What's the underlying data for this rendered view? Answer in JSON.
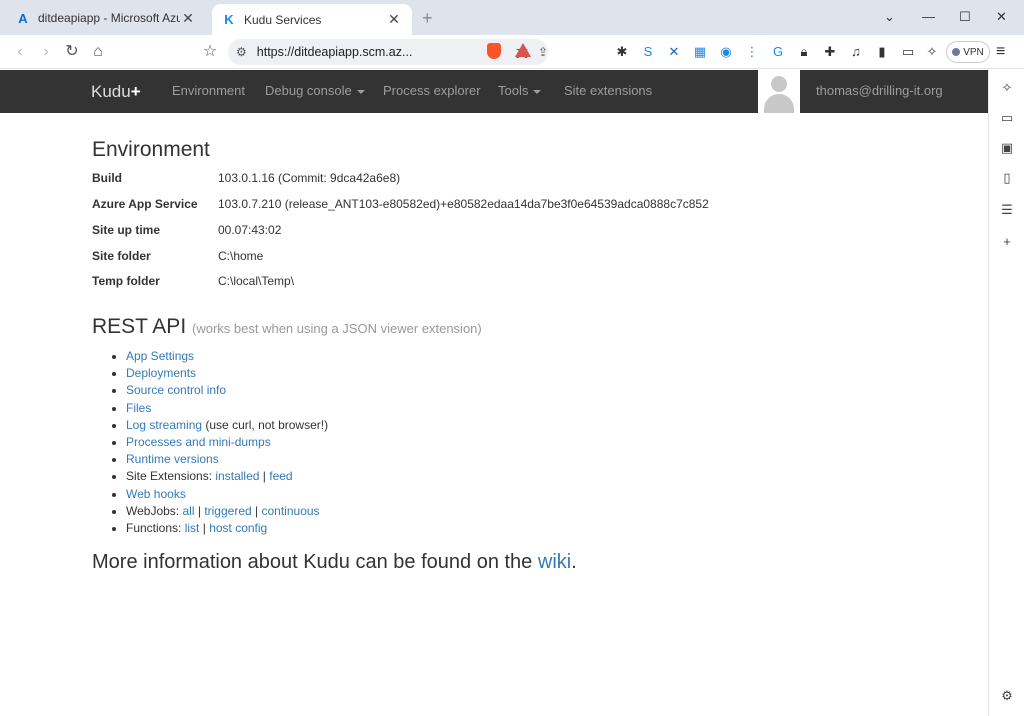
{
  "browser": {
    "tabs": [
      {
        "title": "ditdeapiapp - Microsoft Azure",
        "icon": "azure-icon",
        "active": false
      },
      {
        "title": "Kudu Services",
        "icon": "kudu-icon",
        "active": true
      }
    ],
    "url": "https://ditdeapiapp.scm.az...",
    "vpn_label": "VPN"
  },
  "kudu": {
    "brand": "Kudu",
    "brand_plus": "+",
    "nav": {
      "environment": "Environment",
      "debug_console": "Debug console",
      "process_explorer": "Process explorer",
      "tools": "Tools",
      "site_extensions": "Site extensions"
    },
    "user": "thomas@drilling-it.org"
  },
  "environment": {
    "heading": "Environment",
    "rows": [
      {
        "key": "Build",
        "value": "103.0.1.16 (Commit: 9dca42a6e8)"
      },
      {
        "key": "Azure App Service",
        "value": "103.0.7.210 (release_ANT103-e80582ed)+e80582edaa14da7be3f0e64539adca0888c7c852"
      },
      {
        "key": "Site up time",
        "value": "00.07:43:02"
      },
      {
        "key": "Site folder",
        "value": "C:\\home"
      },
      {
        "key": "Temp folder",
        "value": "C:\\local\\Temp\\"
      }
    ]
  },
  "rest_api": {
    "heading": "REST API",
    "subheading": "(works best when using a JSON viewer extension)",
    "links": {
      "app_settings": "App Settings",
      "deployments": "Deployments",
      "source_control_info": "Source control info",
      "files": "Files",
      "log_streaming": "Log streaming",
      "log_streaming_note": "(use curl, not browser!)",
      "processes": "Processes and mini-dumps",
      "runtime_versions": "Runtime versions",
      "site_extensions_label": "Site Extensions:",
      "installed": "installed",
      "feed": "feed",
      "web_hooks": "Web hooks",
      "webjobs_label": "WebJobs:",
      "all": "all",
      "triggered": "triggered",
      "continuous": "continuous",
      "functions_label": "Functions:",
      "list": "list",
      "host_config": "host config",
      "separator": "|"
    }
  },
  "footer": {
    "more_text": "More information about Kudu can be found on the",
    "wiki": "wiki",
    "period": "."
  }
}
